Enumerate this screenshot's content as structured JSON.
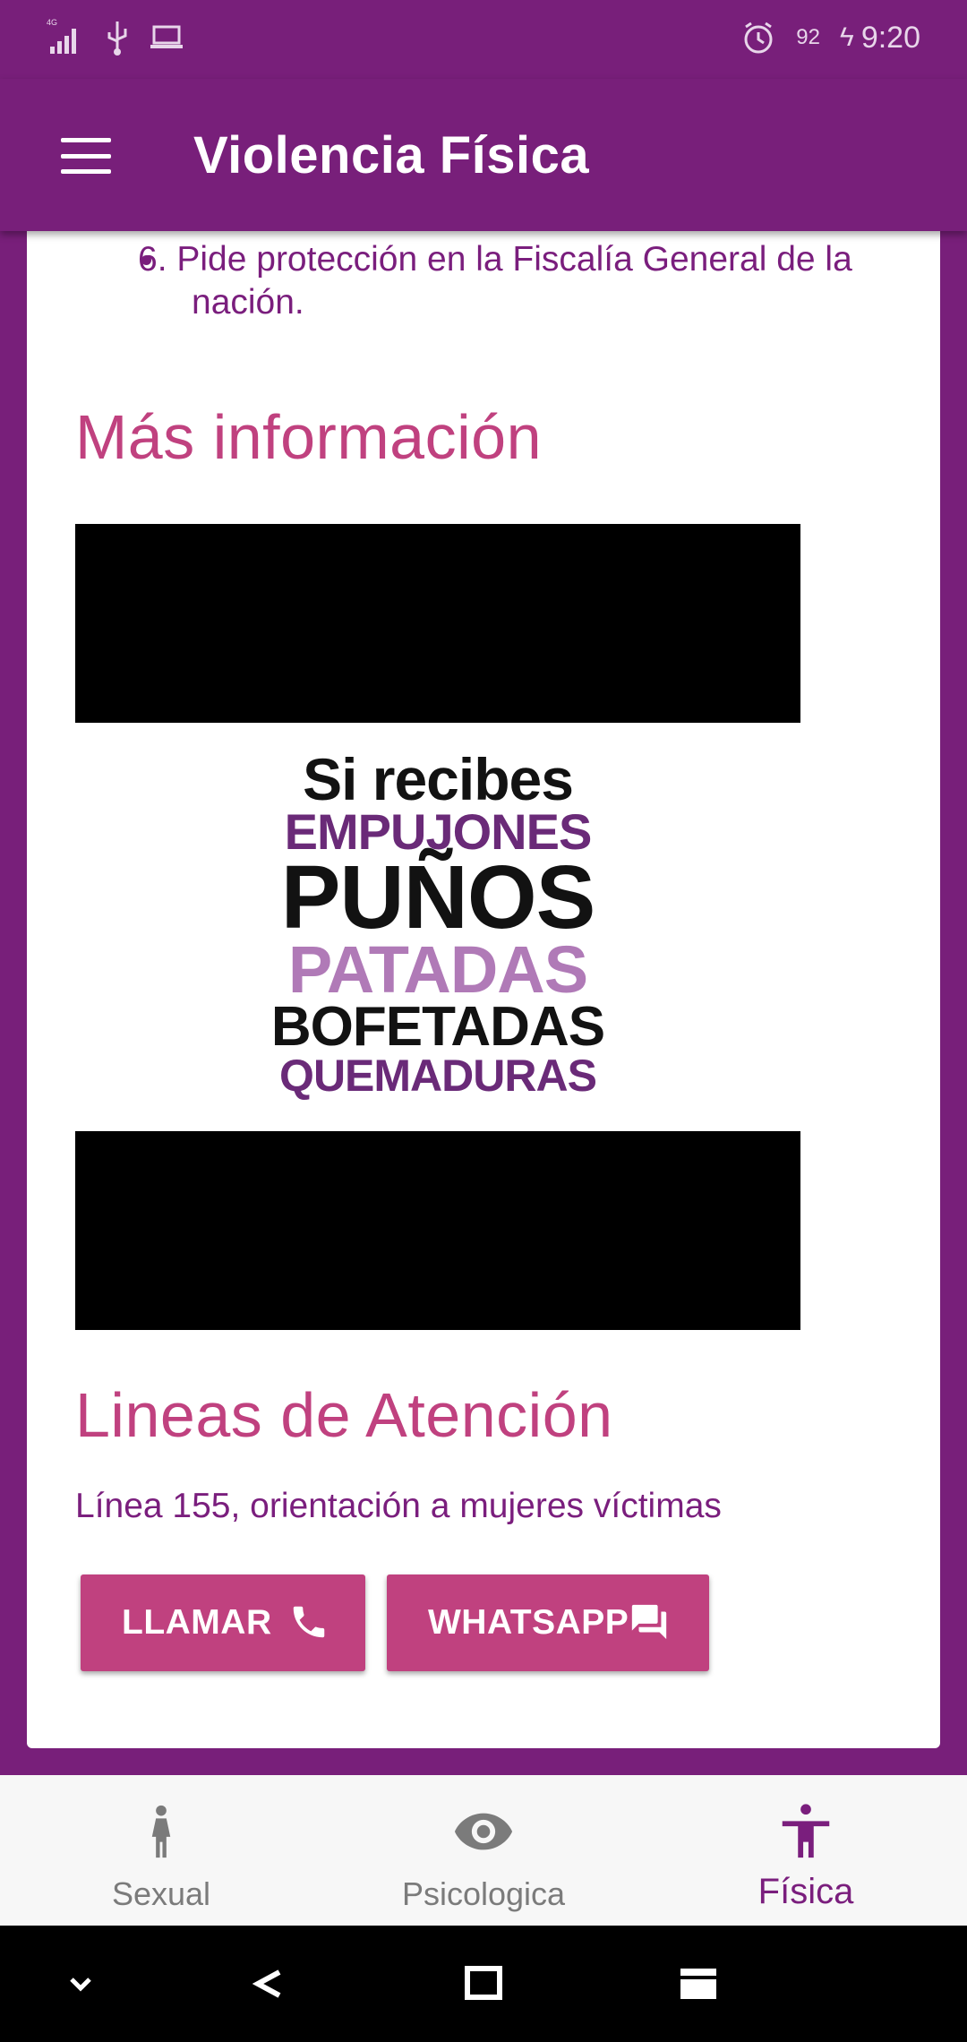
{
  "status_bar": {
    "network": "4G",
    "battery": "92",
    "time": "9:20"
  },
  "app_bar": {
    "title": "Violencia Física"
  },
  "content": {
    "list_item": "6. Pide protección en la Fiscalía General de la nación.",
    "more_info_title": "Más información",
    "poster": {
      "line1": "Si recibes",
      "line2": "EMPUJONES",
      "line3": "PUÑOS",
      "line4": "PATADAS",
      "line5": "BOFETADAS",
      "line6": "QUEMADURAS"
    },
    "hotlines_title": "Lineas de Atención",
    "hotline_desc": "Línea 155, orientación a mujeres víctimas",
    "call_label": "LLAMAR",
    "whatsapp_label": "WHATSAPP"
  },
  "bottom_nav": {
    "items": [
      {
        "label": "Sexual",
        "icon": "woman-icon"
      },
      {
        "label": "Psicologica",
        "icon": "eye-icon"
      },
      {
        "label": "Física",
        "icon": "accessibility-icon",
        "active": true
      }
    ]
  },
  "colors": {
    "primary": "#781f7a",
    "accent": "#c0417f",
    "text": "#7a1e7d"
  }
}
